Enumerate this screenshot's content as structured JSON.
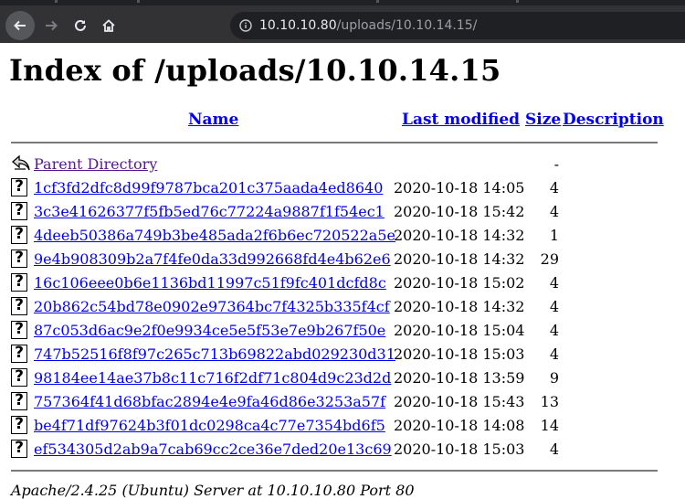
{
  "browser": {
    "url_host": "10.10.10.80",
    "url_path": "/uploads/10.10.14.15/"
  },
  "page": {
    "title": "Index of /uploads/10.10.14.15",
    "columns": {
      "name": "Name",
      "last_modified": "Last modified",
      "size": "Size",
      "description": "Description"
    },
    "parent": {
      "label": "Parent Directory",
      "size": "-"
    },
    "files": [
      {
        "name": "1cf3fd2dfc8d99f9787bca201c375aada4ed8640",
        "modified": "2020-10-18 14:05",
        "size": "4"
      },
      {
        "name": "3c3e41626377f5fb5ed76c77224a9887f1f54ec1",
        "modified": "2020-10-18 15:42",
        "size": "4"
      },
      {
        "name": "4deeb50386a749b3be485ada2f6b6ec720522a5e",
        "modified": "2020-10-18 14:32",
        "size": "1"
      },
      {
        "name": "9e4b908309b2a7f4fe0da33d992668fd4e4b62e6",
        "modified": "2020-10-18 14:32",
        "size": "29"
      },
      {
        "name": "16c106eee0b6e1136bd11997c51f9fc401dcfd8c",
        "modified": "2020-10-18 15:02",
        "size": "4"
      },
      {
        "name": "20b862c54bd78e0902e97364bc7f4325b335f4cf",
        "modified": "2020-10-18 14:32",
        "size": "4"
      },
      {
        "name": "87c053d6ac9e2f0e9934ce5e5f53e7e9b267f50e",
        "modified": "2020-10-18 15:04",
        "size": "4"
      },
      {
        "name": "747b52516f8f97c265c713b69822abd029230d31",
        "modified": "2020-10-18 15:03",
        "size": "4"
      },
      {
        "name": "98184ee14ae37b8c11c716f2df71c804d9c23d2d",
        "modified": "2020-10-18 13:59",
        "size": "9"
      },
      {
        "name": "757364f41d68bfac2894e4e9fa46d86e3253a57f",
        "modified": "2020-10-18 15:43",
        "size": "13"
      },
      {
        "name": "be4f71df97624b3f01dc0298ca4c77e7354bd6f5",
        "modified": "2020-10-18 14:08",
        "size": "14"
      },
      {
        "name": "ef534305d2ab9a7cab69cc2ce36e7ded20e13c69",
        "modified": "2020-10-18 15:03",
        "size": "4"
      }
    ],
    "footer": "Apache/2.4.25 (Ubuntu) Server at 10.10.10.80 Port 80"
  }
}
